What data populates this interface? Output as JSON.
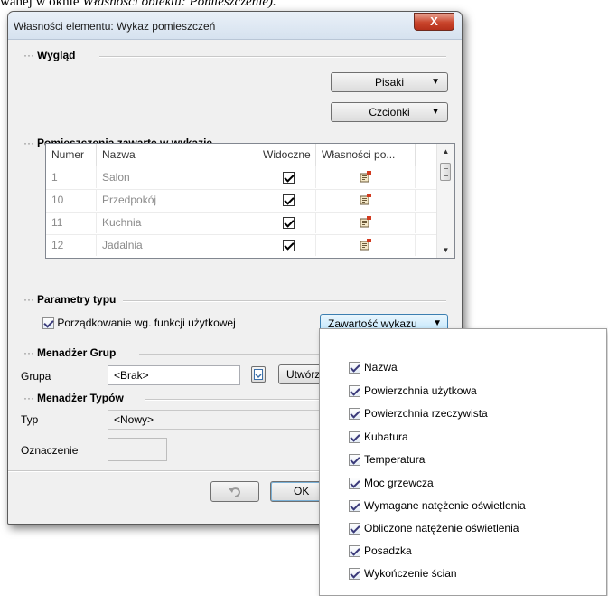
{
  "caption": {
    "prefix": "wanej w oknie ",
    "italic": "Własności obiektu: Pomieszczenie)."
  },
  "dialog": {
    "title": "Własności elementu: Wykaz pomieszczeń",
    "close_label": "X"
  },
  "sections": {
    "wyglad": "Wygląd",
    "pomieszczenia": "Pomieszczenia zawarte w wykazie",
    "parametry": "Parametry typu",
    "menadzer_grup": "Menadżer Grup",
    "menadzer_typow": "Menadżer Typów"
  },
  "buttons": {
    "pisaki": "Pisaki",
    "czcionki": "Czcionki",
    "zawartosc": "Zawartość wykazu",
    "utworz": "Utwórz",
    "ok": "OK",
    "undo_icon": "undo-icon"
  },
  "table": {
    "headers": [
      "Numer",
      "Nazwa",
      "Widoczne",
      "Własności po..."
    ],
    "rows": [
      {
        "numer": "1",
        "nazwa": "Salon",
        "widoczne": true
      },
      {
        "numer": "10",
        "nazwa": "Przedpokój",
        "widoczne": true
      },
      {
        "numer": "11",
        "nazwa": "Kuchnia",
        "widoczne": true
      },
      {
        "numer": "12",
        "nazwa": "Jadalnia",
        "widoczne": true
      }
    ]
  },
  "parametry": {
    "porzadkowanie_label": "Porządkowanie wg. funkcji użytkowej",
    "porzadkowanie_checked": true
  },
  "grupy": {
    "label": "Grupa",
    "value": "<Brak>"
  },
  "typy": {
    "typ_label": "Typ",
    "typ_value": "<Nowy>",
    "oznaczenie_label": "Oznaczenie",
    "oznaczenie_value": ""
  },
  "popup": {
    "items": [
      {
        "label": "Nazwa",
        "checked": true
      },
      {
        "label": "Powierzchnia użytkowa",
        "checked": true
      },
      {
        "label": "Powierzchnia rzeczywista",
        "checked": true
      },
      {
        "label": "Kubatura",
        "checked": true
      },
      {
        "label": "Temperatura",
        "checked": true
      },
      {
        "label": "Moc grzewcza",
        "checked": true
      },
      {
        "label": "Wymagane natężenie oświetlenia",
        "checked": true
      },
      {
        "label": "Obliczone natężenie oświetlenia",
        "checked": true
      },
      {
        "label": "Posadzka",
        "checked": true
      },
      {
        "label": "Wykończenie ścian",
        "checked": true
      }
    ]
  }
}
